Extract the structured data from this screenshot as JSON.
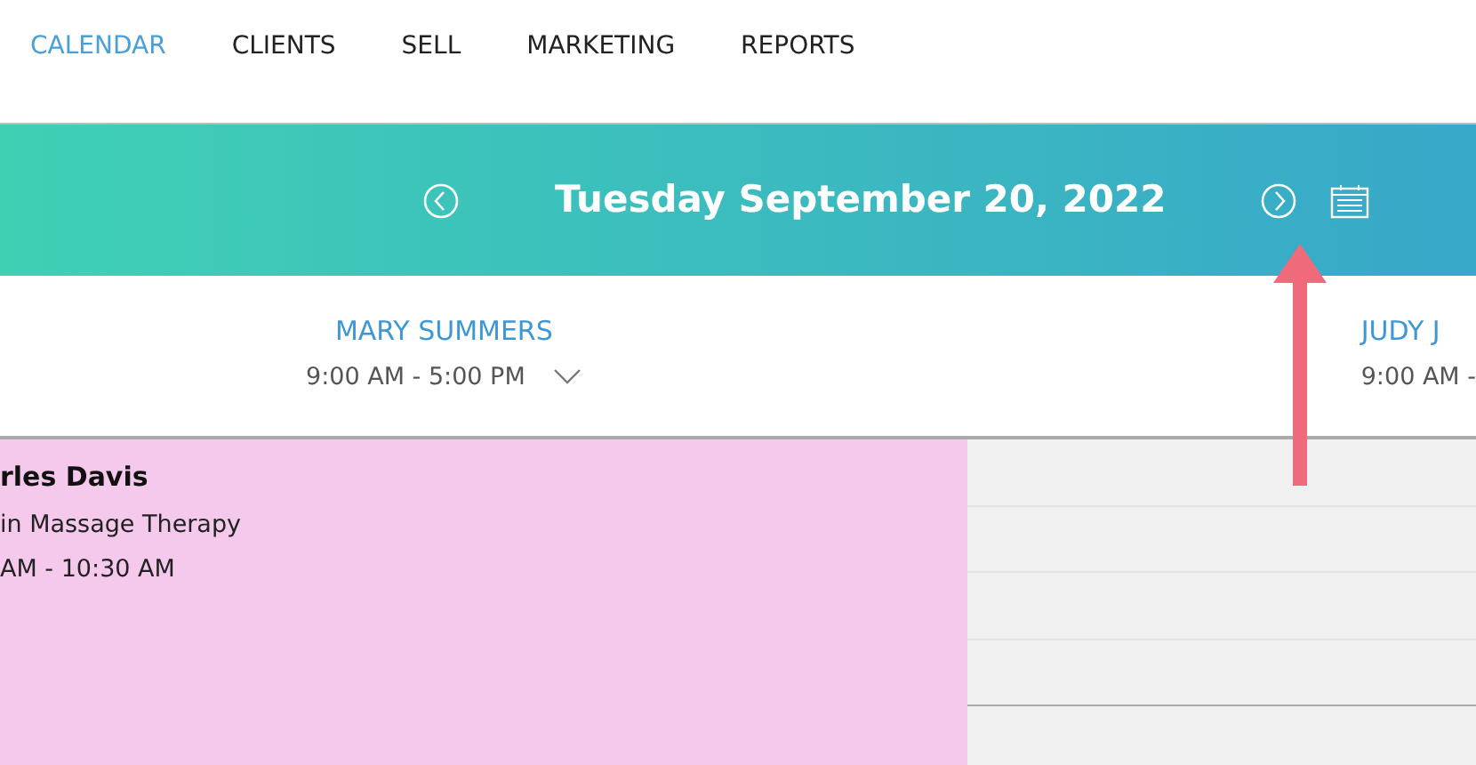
{
  "nav": [
    {
      "label": "CALENDAR",
      "selected": true
    },
    {
      "label": "CLIENTS",
      "selected": false
    },
    {
      "label": "SELL",
      "selected": false
    },
    {
      "label": "MARKETING",
      "selected": false
    },
    {
      "label": "REPORTS",
      "selected": false
    }
  ],
  "date_bar": {
    "title": "Tuesday September 20, 2022"
  },
  "staff": [
    {
      "name": "MARY SUMMERS",
      "hours": "9:00 AM - 5:00 PM",
      "dropdown": true
    },
    {
      "name": "JUDY J",
      "hours": "9:00 AM -",
      "dropdown": false
    }
  ],
  "appointment": {
    "client": "rles Davis",
    "service": "in Massage Therapy",
    "time": "AM - 10:30 AM",
    "color": "#f5c9ec"
  }
}
